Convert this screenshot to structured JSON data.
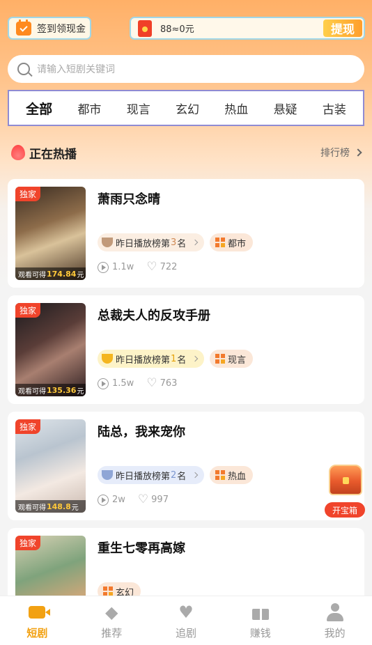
{
  "topbar": {
    "checkin_label": "签到领现金",
    "wallet_amount": "88≈0元",
    "withdraw_label": "提现"
  },
  "search": {
    "placeholder": "请输入短剧关键词"
  },
  "categories": [
    "全部",
    "都市",
    "现言",
    "玄幻",
    "热血",
    "悬疑",
    "古装"
  ],
  "section": {
    "title": "正在热播",
    "rank_link": "排行榜"
  },
  "dramas": [
    {
      "badge": "独家",
      "title": "萧雨只念晴",
      "earn_prefix": "观看可得",
      "earn_amount": "174.84",
      "earn_unit": "元",
      "rank_prefix": "昨日播放榜第",
      "rank_num": "3",
      "rank_suffix": "名",
      "genre": "都市",
      "plays": "1.1w",
      "likes": "722"
    },
    {
      "badge": "独家",
      "title": "总裁夫人的反攻手册",
      "earn_prefix": "观看可得",
      "earn_amount": "135.36",
      "earn_unit": "元",
      "rank_prefix": "昨日播放榜第",
      "rank_num": "1",
      "rank_suffix": "名",
      "genre": "现言",
      "plays": "1.5w",
      "likes": "763"
    },
    {
      "badge": "独家",
      "title": "陆总，我来宠你",
      "earn_prefix": "观看可得",
      "earn_amount": "148.8",
      "earn_unit": "元",
      "rank_prefix": "昨日播放榜第",
      "rank_num": "2",
      "rank_suffix": "名",
      "genre": "热血",
      "plays": "2w",
      "likes": "997"
    },
    {
      "badge": "独家",
      "title": "重生七零再高嫁",
      "genre": "玄幻"
    }
  ],
  "treasure": {
    "label": "开宝箱"
  },
  "bottom_nav": [
    {
      "label": "短剧",
      "icon": "video-icon",
      "active": true
    },
    {
      "label": "推荐",
      "icon": "diamond-icon"
    },
    {
      "label": "追剧",
      "icon": "heart-icon"
    },
    {
      "label": "赚钱",
      "icon": "gift-icon"
    },
    {
      "label": "我的",
      "icon": "person-icon"
    }
  ],
  "colors": {
    "accent": "#f2a112",
    "badge_red": "#f0442b",
    "top_gradient": "#ffb067"
  }
}
